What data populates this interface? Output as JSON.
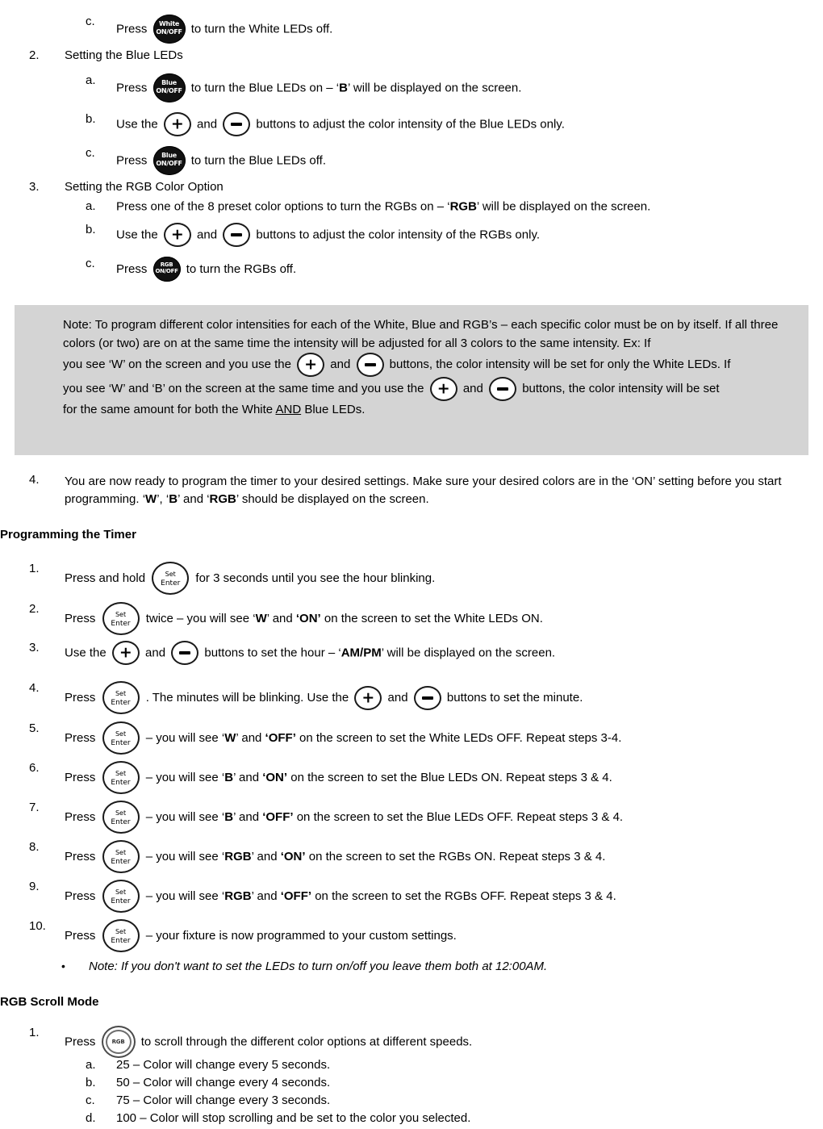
{
  "icons": {
    "white_onoff": {
      "name": "white-onoff-button",
      "line1": "White",
      "line2": "ON/OFF"
    },
    "blue_onoff": {
      "name": "blue-onoff-button",
      "line1": "Blue",
      "line2": "ON/OFF"
    },
    "rgb_onoff": {
      "name": "rgb-onoff-button",
      "line1": "RGB",
      "line2": "ON/OFF"
    },
    "plus": {
      "name": "plus-button",
      "glyph": "+"
    },
    "minus": {
      "name": "minus-button",
      "glyph": "−"
    },
    "set_enter": {
      "name": "set-enter-button",
      "line1": "Set",
      "line2": "Enter"
    },
    "rgb_scroll": {
      "name": "rgb-scroll-button",
      "label": "RGB"
    }
  },
  "section_white_tail": {
    "marker": "c.",
    "text_before": "Press",
    "text_after": "to turn the White LEDs off."
  },
  "section_blue": {
    "marker": "2.",
    "title": "Setting the Blue LEDs",
    "items": [
      {
        "marker": "a.",
        "before": "Press",
        "after_1": "to turn the Blue LEDs on – ‘",
        "bold": "B",
        "after_2": "’ will be displayed on the screen."
      },
      {
        "marker": "b.",
        "before": "Use the",
        "mid": "and",
        "after": "buttons to adjust the color intensity of the Blue LEDs only."
      },
      {
        "marker": "c.",
        "before": "Press",
        "after": "to turn the Blue LEDs off."
      }
    ]
  },
  "section_rgb": {
    "marker": "3.",
    "title": "Setting the RGB Color Option",
    "items": [
      {
        "marker": "a.",
        "text_1": "Press one of the 8 preset color options to turn the RGBs on – ‘",
        "bold": "RGB",
        "text_2": "’ will be displayed on the screen."
      },
      {
        "marker": "b.",
        "before": "Use the",
        "mid": "and",
        "after": "buttons to adjust the color intensity of the RGBs only."
      },
      {
        "marker": "c.",
        "before": "Press",
        "after": "to turn the RGBs off."
      }
    ]
  },
  "note_box": {
    "para1": "Note: To program different color intensities for each of the White, Blue and RGB’s – each specific color must be on by itself. If all three colors (or two) are on at the same time the intensity will be adjusted for all 3 colors to the same intensity.  Ex: If",
    "para2_before": "you see ‘W’ on the screen and you use the",
    "para2_mid": "and",
    "para2_after": "buttons, the color intensity will be set for only the White LEDs. If",
    "para3_before": "you see ‘W’ and ‘B’ on the screen at the same time and you use the",
    "para3_mid": "and",
    "para3_after": "buttons, the color intensity will be set",
    "para4_before": "for the same amount for both the White ",
    "para4_underline": "AND",
    "para4_after": " Blue LEDs."
  },
  "step4": {
    "marker": "4.",
    "text_1": "You are now ready to program the timer to your desired settings. Make sure your desired colors are in the ‘ON’ setting before you start programming. ‘",
    "bold_1": "W",
    "text_2": "’, ‘",
    "bold_2": "B",
    "text_3": "’ and ‘",
    "bold_3": "RGB",
    "text_4": "’ should be displayed on the screen."
  },
  "timer_heading": "Programming the Timer",
  "timer_steps": [
    {
      "marker": "1.",
      "before": "Press and hold",
      "after": "for 3 seconds until you see the hour blinking."
    },
    {
      "marker": "2.",
      "before": "Press",
      "after_1": "twice – you will see ‘",
      "bold_1": "W",
      "after_2": "’ and ",
      "bold_2": "‘ON’",
      "after_3": " on the screen to set the White LEDs ON."
    },
    {
      "marker": "3.",
      "before": "Use the",
      "mid": "and",
      "after_1": "buttons to set the hour – ‘",
      "bold_1": "AM/PM",
      "after_2": "’ will be displayed on the screen."
    },
    {
      "marker": "4.",
      "before": "Press",
      "after_1": ". The minutes will be blinking. Use the",
      "mid": "and",
      "after_2": "buttons to set the minute."
    },
    {
      "marker": "5.",
      "before": "Press",
      "after_1": "– you will see ‘",
      "bold_1": "W",
      "after_2": "’ and ",
      "bold_2": "‘OFF’",
      "after_3": " on the screen to set the White LEDs OFF. Repeat steps 3-4."
    },
    {
      "marker": "6.",
      "before": "Press",
      "after_1": "– you will see ‘",
      "bold_1": "B",
      "after_2": "’ and ",
      "bold_2": "‘ON’",
      "after_3": " on the screen to set the Blue LEDs ON. Repeat steps 3 & 4."
    },
    {
      "marker": "7.",
      "before": "Press",
      "after_1": "– you will see ‘",
      "bold_1": "B",
      "after_2": "’ and ",
      "bold_2": "‘OFF’",
      "after_3": " on the screen to set the Blue LEDs OFF. Repeat steps 3 & 4."
    },
    {
      "marker": "8.",
      "before": "Press",
      "after_1": "– you will see ‘",
      "bold_1": "RGB",
      "after_2": "’ and ",
      "bold_2": "‘ON’",
      "after_3": " on the screen to set the RGBs ON. Repeat steps 3 & 4."
    },
    {
      "marker": "9.",
      "before": "Press",
      "after_1": "– you will see ‘",
      "bold_1": "RGB",
      "after_2": "’ and ",
      "bold_2": "‘OFF’",
      "after_3": " on the screen to set the RGBs OFF. Repeat steps 3 & 4."
    },
    {
      "marker": "10.",
      "before": "Press",
      "after_1": "– your fixture is now programmed to your custom settings."
    }
  ],
  "timer_note_bullet": {
    "dot": "•",
    "text": "Note: If you don't want to set the LEDs to turn on/off you leave them both at 12:00AM."
  },
  "scroll_heading": "RGB Scroll Mode",
  "scroll_step": {
    "marker": "1.",
    "before": "Press",
    "after": "to scroll through the different color options at different speeds."
  },
  "scroll_items": [
    {
      "marker": "a.",
      "text": "25 – Color will change every 5 seconds."
    },
    {
      "marker": "b.",
      "text": "50 – Color will change every 4 seconds."
    },
    {
      "marker": "c.",
      "text": "75 – Color will change every 3 seconds."
    },
    {
      "marker": "d.",
      "text": "100 – Color will stop scrolling and be set to the color you selected."
    }
  ],
  "colors": {
    "note_background": "#d4d4d4",
    "text": "#000000",
    "button_fill": "#111111"
  }
}
